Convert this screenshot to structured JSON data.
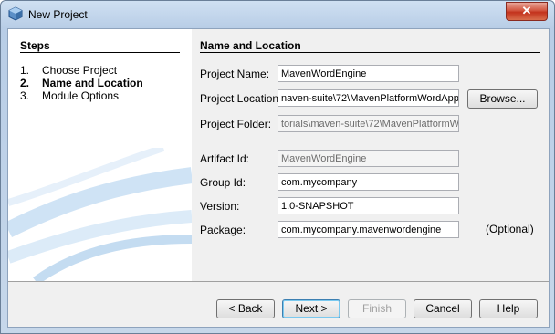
{
  "window": {
    "title": "New Project",
    "close_label": "✕"
  },
  "steps": {
    "title": "Steps",
    "items": [
      {
        "num": "1.",
        "label": "Choose Project"
      },
      {
        "num": "2.",
        "label": "Name and Location"
      },
      {
        "num": "3.",
        "label": "Module Options"
      }
    ]
  },
  "form": {
    "title": "Name and Location",
    "project_name": {
      "label": "Project Name:",
      "value": "MavenWordEngine"
    },
    "project_location": {
      "label": "Project Location:",
      "value": "naven-suite\\72\\MavenPlatformWordApp"
    },
    "browse_label": "Browse...",
    "project_folder": {
      "label": "Project Folder:",
      "value": "torials\\maven-suite\\72\\MavenPlatformW"
    },
    "artifact_id": {
      "label": "Artifact Id:",
      "value": "MavenWordEngine"
    },
    "group_id": {
      "label": "Group Id:",
      "value": "com.mycompany"
    },
    "version": {
      "label": "Version:",
      "value": "1.0-SNAPSHOT"
    },
    "package": {
      "label": "Package:",
      "value": "com.mycompany.mavenwordengine",
      "note": "(Optional)"
    }
  },
  "buttons": {
    "back": "< Back",
    "next": "Next >",
    "finish": "Finish",
    "cancel": "Cancel",
    "help": "Help"
  }
}
